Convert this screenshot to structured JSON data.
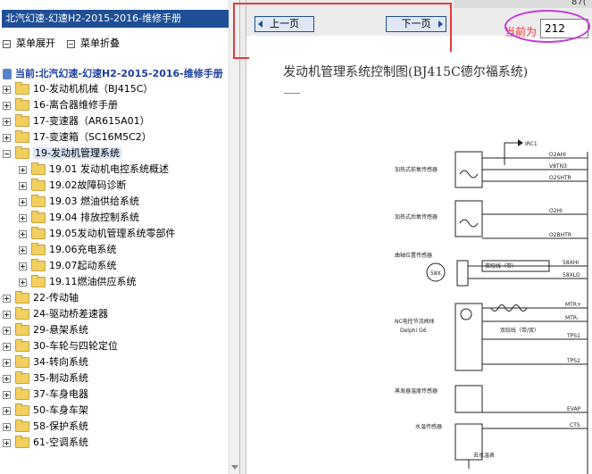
{
  "manual": {
    "title": "北汽幻速-幻速H2-2015-2016-维修手册",
    "expand_all": "菜单展开",
    "collapse_all": "菜单折叠",
    "current_label": "当前:北汽幻速-幻速H2-2015-2016-维修手册"
  },
  "tree": [
    {
      "label": "10-发动机机械（BJ415C）",
      "level": 0,
      "expanded": false
    },
    {
      "label": "16-离合器维修手册",
      "level": 0,
      "expanded": false
    },
    {
      "label": "17-变速器（AR615A01）",
      "level": 0,
      "expanded": false
    },
    {
      "label": "17-变速箱（SC16M5C2）",
      "level": 0,
      "expanded": false
    },
    {
      "label": "19-发动机管理系统",
      "level": 0,
      "expanded": true,
      "selected": true
    },
    {
      "label": "19.01 发动机电控系统概述",
      "level": 1,
      "expanded": false
    },
    {
      "label": "19.02故障码诊断",
      "level": 1,
      "expanded": false
    },
    {
      "label": "19.03 燃油供给系统",
      "level": 1,
      "expanded": false
    },
    {
      "label": "19.04 排放控制系统",
      "level": 1,
      "expanded": false
    },
    {
      "label": "19.05发动机管理系统零部件",
      "level": 1,
      "expanded": false
    },
    {
      "label": "19.06充电系统",
      "level": 1,
      "expanded": false
    },
    {
      "label": "19.07起动系统",
      "level": 1,
      "expanded": false
    },
    {
      "label": "19.11燃油供应系统",
      "level": 1,
      "expanded": false
    },
    {
      "label": "22-传动轴",
      "level": 0,
      "expanded": false
    },
    {
      "label": "24-驱动桥差速器",
      "level": 0,
      "expanded": false
    },
    {
      "label": "29-悬架系统",
      "level": 0,
      "expanded": false
    },
    {
      "label": "30-车轮与四轮定位",
      "level": 0,
      "expanded": false
    },
    {
      "label": "34-转向系统",
      "level": 0,
      "expanded": false
    },
    {
      "label": "35-制动系统",
      "level": 0,
      "expanded": false
    },
    {
      "label": "37-车身电器",
      "level": 0,
      "expanded": false
    },
    {
      "label": "50-车身车架",
      "level": 0,
      "expanded": false
    },
    {
      "label": "58-保护系统",
      "level": 0,
      "expanded": false
    },
    {
      "label": "61-空调系统",
      "level": 0,
      "expanded": false
    }
  ],
  "nav": {
    "prev_label": "上一页",
    "next_label": "下一页",
    "page_label": "当前为",
    "page_value": "212",
    "corner_text": "87("
  },
  "document": {
    "title": "发动机管理系统控制图(BJ415C德尔福系统)",
    "labels": {
      "fuse": "IRC1",
      "pre_o2": "加热式前氧传感器",
      "post_o2": "加热式后氧传感器",
      "crank": "曲轴位置传感器",
      "crank_code": "58X",
      "shield": "双绞线（带）",
      "throttle_1": "NC电控节流阀体",
      "throttle_2": "Delphi G6",
      "twisted": "双绞线（带/双）",
      "evap": "蒸发器温度传感器",
      "coolant": "水温传感器",
      "coolant_note": "去水温表",
      "pins": [
        "O2AHI",
        "V8TN3",
        "O2SHTR",
        "O2HI",
        "O2BHTR",
        "58XHI",
        "58XLO",
        "MTR+",
        "MTR-",
        "TPS1",
        "TPS2",
        "EVAP",
        "CTS"
      ]
    }
  },
  "colors": {
    "title_bar": "#1f4f96",
    "current_text": "#1c3fa0",
    "annotation_red": "#e8383c",
    "annotation_purple": "#c33bd9"
  }
}
